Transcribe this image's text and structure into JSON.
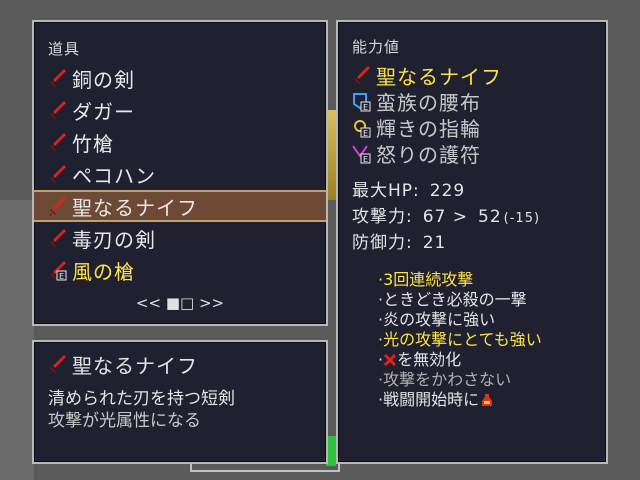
{
  "inventory": {
    "title": "道具",
    "items": [
      {
        "name": "銅の剣",
        "icon": "sword-icon",
        "color": "#e8e8e8"
      },
      {
        "name": "ダガー",
        "icon": "sword-icon",
        "color": "#e8e8e8"
      },
      {
        "name": "竹槍",
        "icon": "sword-icon",
        "color": "#e8e8e8"
      },
      {
        "name": "ペコハン",
        "icon": "sword-icon",
        "color": "#e8e8e8"
      },
      {
        "name": "聖なるナイフ",
        "icon": "sword-icon",
        "color": "#e8e8e8",
        "selected": true
      },
      {
        "name": "毒刃の剣",
        "icon": "sword-icon",
        "color": "#e8e8e8"
      },
      {
        "name": "風の槍",
        "icon": "equipped-sword-icon",
        "color": "#ffe24a"
      }
    ],
    "pager": "<< ■□ >>"
  },
  "detail": {
    "name": "聖なるナイフ",
    "line1": "清められた刃を持つ短剣",
    "line2": "攻撃が光属性になる"
  },
  "status": {
    "title": "能力値",
    "equipment": [
      {
        "name": "聖なるナイフ",
        "icon": "sword-icon",
        "color": "#ffe24a"
      },
      {
        "name": "蛮族の腰布",
        "icon": "armor-icon",
        "color": "#c8c8c8"
      },
      {
        "name": "輝きの指輪",
        "icon": "ring-icon",
        "color": "#c8c8c8"
      },
      {
        "name": "怒りの護符",
        "icon": "amulet-icon",
        "color": "#c8c8c8"
      }
    ],
    "stats": [
      {
        "label": "最大HP:",
        "value": "229",
        "extra": ""
      },
      {
        "label": "攻撃力:",
        "value": "67 >",
        "extra": "52",
        "delta": "(-15)"
      },
      {
        "label": "防御力:",
        "value": "21",
        "extra": ""
      }
    ],
    "abilities": [
      {
        "text": "·3回連続攻撃",
        "color": "#ffe24a"
      },
      {
        "text": "·ときどき必殺の一撃",
        "color": "#e4e4e4"
      },
      {
        "text": "·炎の攻撃に強い",
        "color": "#e4e4e4"
      },
      {
        "text": "·光の攻撃にとても強い",
        "color": "#ffe24a"
      },
      {
        "text": "·を無効化",
        "color": "#e4e4e4",
        "icon": "x-mark-icon"
      },
      {
        "text": "·攻撃をかわさない",
        "color": "#b0b0b0"
      },
      {
        "text": "·戦闘開始時に",
        "color": "#e4e4e4",
        "icon": "potion-icon"
      }
    ]
  },
  "colors": {
    "panel_bg": "#1f2030",
    "border": "#b8b8b8",
    "highlight": "#6e4a36",
    "yellow": "#ffe24a"
  }
}
